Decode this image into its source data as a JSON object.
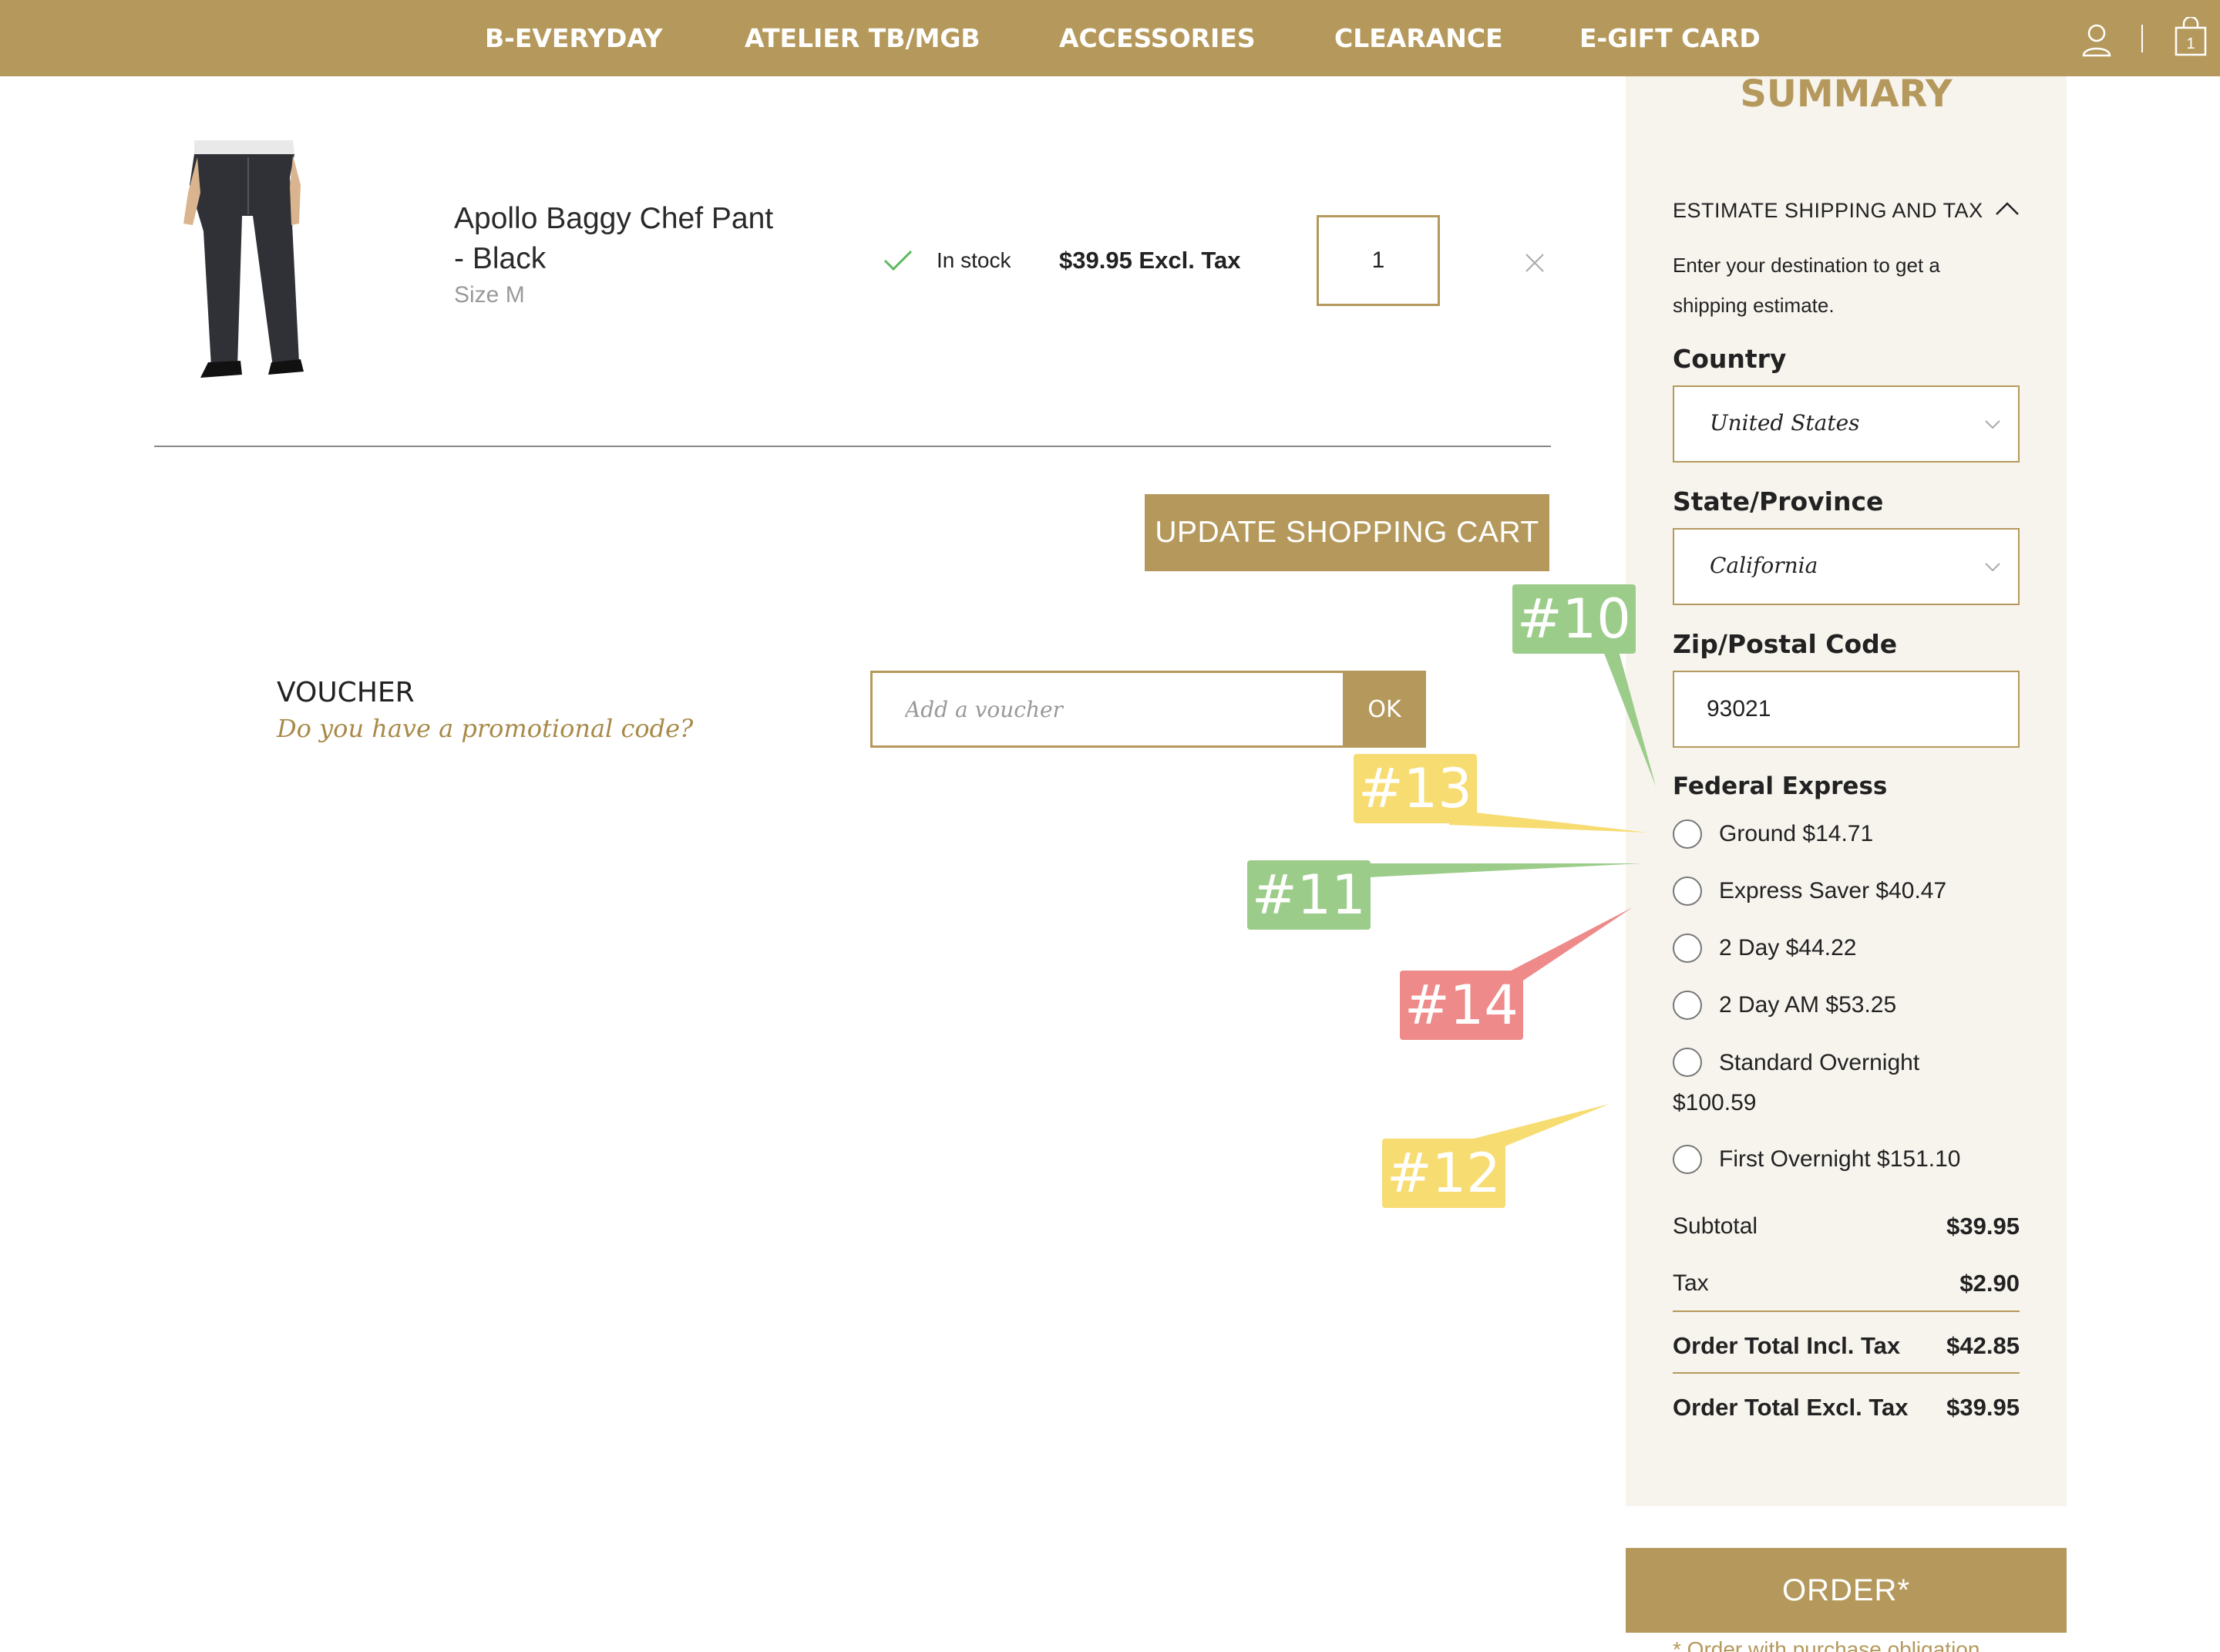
{
  "nav": {
    "items": [
      "B-EVERYDAY",
      "ATELIER TB/MGB",
      "ACCESSORIES",
      "CLEARANCE",
      "E-GIFT CARD"
    ],
    "cart_count": "1",
    "icons": [
      "user-icon",
      "cart-icon"
    ]
  },
  "cart": {
    "item": {
      "name": "Apollo Baggy Chef Pant - Black",
      "size": "Size M",
      "stock": "In stock",
      "price": "$39.95 Excl. Tax",
      "qty": "1"
    },
    "update_label": "UPDATE SHOPPING CART"
  },
  "voucher": {
    "title": "VOUCHER",
    "subtitle": "Do you have a promotional code?",
    "placeholder": "Add a voucher",
    "ok_label": "OK"
  },
  "summary": {
    "title": "SUMMARY",
    "estimate_title": "ESTIMATE SHIPPING AND TAX",
    "estimate_desc": "Enter your destination to get a shipping estimate.",
    "country_label": "Country",
    "country_value": "United States",
    "state_label": "State/Province",
    "state_value": "California",
    "zip_label": "Zip/Postal Code",
    "zip_value": "93021",
    "carrier": "Federal Express",
    "options": [
      "Ground $14.71",
      "Express Saver $40.47",
      "2 Day $44.22",
      "2 Day AM $53.25",
      "Standard Overnight $100.59",
      "First Overnight $151.10"
    ],
    "totals": {
      "subtotal_label": "Subtotal",
      "subtotal": "$39.95",
      "tax_label": "Tax",
      "tax": "$2.90",
      "incl_label": "Order Total Incl. Tax",
      "incl": "$42.85",
      "excl_label": "Order Total Excl. Tax",
      "excl": "$39.95"
    },
    "order_label": "ORDER*",
    "order_note": "* Order with purchase obligation"
  },
  "tags": [
    "#10",
    "#11",
    "#12",
    "#13",
    "#14"
  ],
  "colors": {
    "accent": "#b5995c",
    "panel": "#f7f4ee",
    "tag_green": "#9ccc8a",
    "tag_yellow": "#f7dc72",
    "tag_red": "#ee8a8a"
  }
}
